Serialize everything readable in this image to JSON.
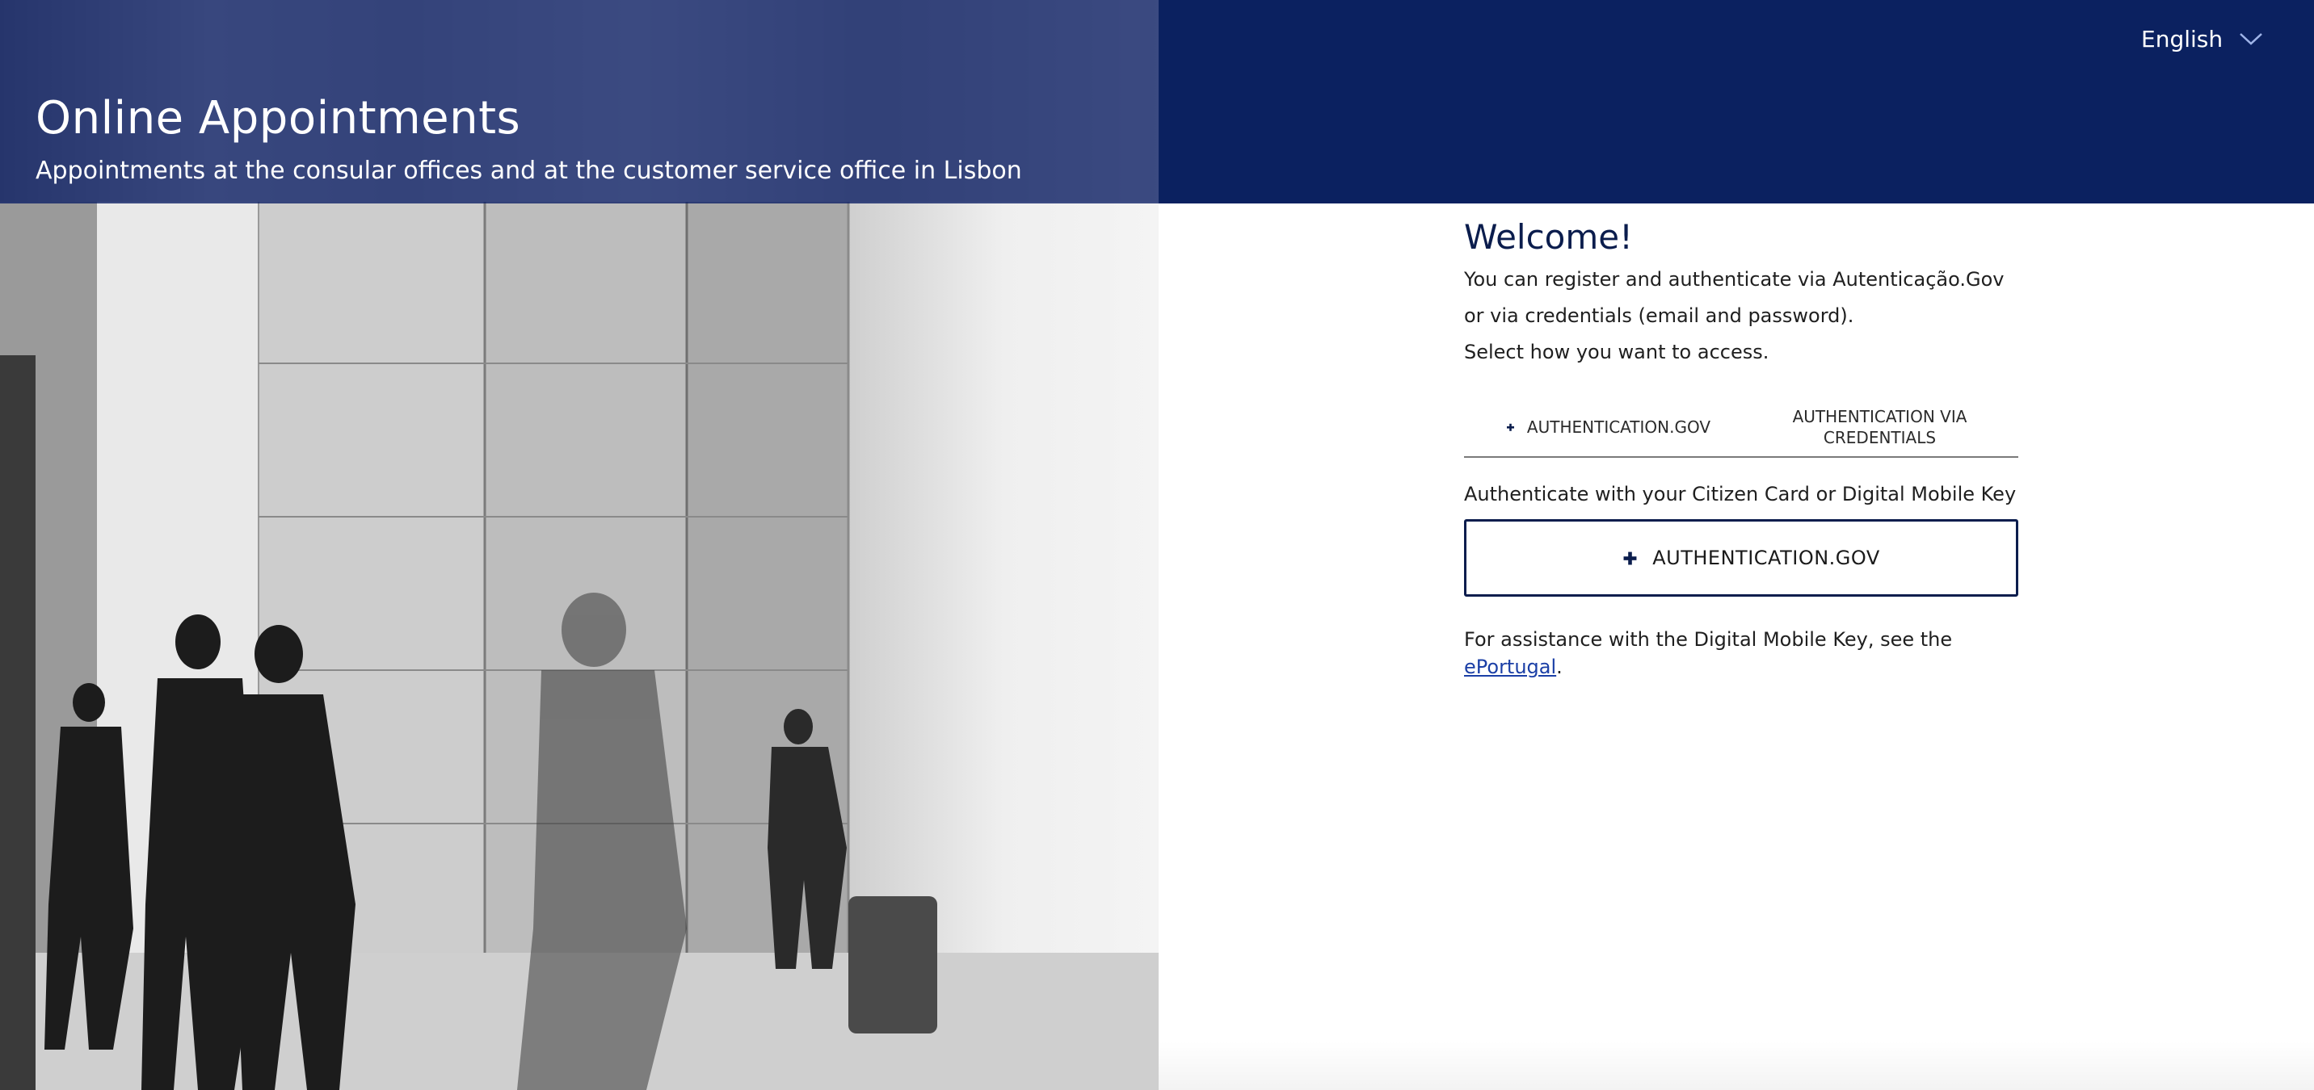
{
  "header": {
    "title": "Online Appointments",
    "subtitle": "Appointments at the consular offices and at the customer service office in Lisbon",
    "language": {
      "selected": "English",
      "icon": "chevron-down-icon"
    }
  },
  "main": {
    "welcome": "Welcome!",
    "intro_line_1": "You can register and authenticate via Autenticação.Gov or via credentials (email and password).",
    "intro_line_2": "Select how you want to access.",
    "tabs": [
      {
        "label": "AUTHENTICATION.GOV",
        "icon": "autenticacao-gov-icon",
        "active": true
      },
      {
        "label": "AUTHENTICATION VIA CREDENTIALS",
        "active": false
      }
    ],
    "auth_text": "Authenticate with your Citizen Card or Digital Mobile Key",
    "auth_button_label": "AUTHENTICATION.GOV",
    "assist_prefix": "For assistance with the Digital Mobile Key, see the ",
    "assist_link": "ePortugal",
    "assist_suffix": "."
  },
  "colors": {
    "header_bg": "#0b2160",
    "heading": "#0b1d4d",
    "link": "#1b3fa6",
    "button_border": "#0b1d4d"
  }
}
